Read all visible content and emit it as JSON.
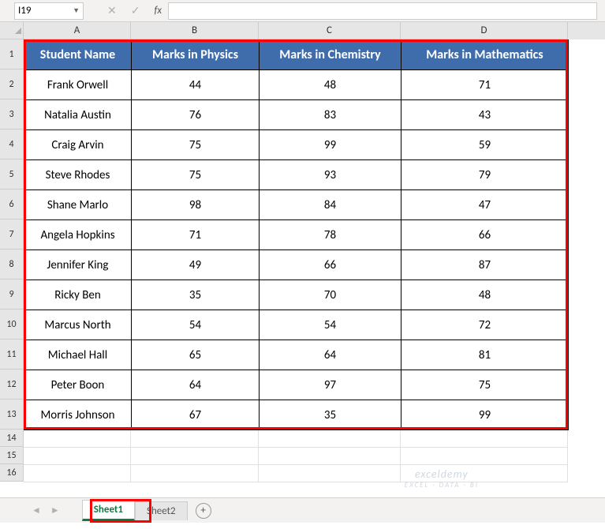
{
  "namebox": {
    "value": "I19"
  },
  "columns": [
    "A",
    "B",
    "C",
    "D"
  ],
  "headers": {
    "name": "Student Name",
    "physics": "Marks in Physics",
    "chemistry": "Marks in Chemistry",
    "math": "Marks in Mathematics"
  },
  "rows": [
    {
      "n": "1"
    },
    {
      "n": "2",
      "name": "Frank Orwell",
      "phy": "44",
      "chem": "48",
      "math": "71"
    },
    {
      "n": "3",
      "name": "Natalia Austin",
      "phy": "76",
      "chem": "83",
      "math": "43"
    },
    {
      "n": "4",
      "name": "Craig Arvin",
      "phy": "75",
      "chem": "99",
      "math": "59"
    },
    {
      "n": "5",
      "name": "Steve Rhodes",
      "phy": "75",
      "chem": "93",
      "math": "79"
    },
    {
      "n": "6",
      "name": "Shane Marlo",
      "phy": "98",
      "chem": "84",
      "math": "47"
    },
    {
      "n": "7",
      "name": "Angela Hopkins",
      "phy": "71",
      "chem": "78",
      "math": "66"
    },
    {
      "n": "8",
      "name": "Jennifer King",
      "phy": "49",
      "chem": "66",
      "math": "87"
    },
    {
      "n": "9",
      "name": "Ricky Ben",
      "phy": "35",
      "chem": "70",
      "math": "48"
    },
    {
      "n": "10",
      "name": "Marcus North",
      "phy": "54",
      "chem": "54",
      "math": "72"
    },
    {
      "n": "11",
      "name": "Michael Hall",
      "phy": "65",
      "chem": "64",
      "math": "81"
    },
    {
      "n": "12",
      "name": "Peter Boon",
      "phy": "64",
      "chem": "97",
      "math": "75"
    },
    {
      "n": "13",
      "name": "Morris Johnson",
      "phy": "67",
      "chem": "35",
      "math": "99"
    }
  ],
  "empty_rows": [
    "14",
    "15",
    "16"
  ],
  "tabs": {
    "active": "Sheet1",
    "inactive": "Sheet2"
  },
  "watermark": {
    "main": "exceldemy",
    "sub": "EXCEL · DATA · BI"
  }
}
